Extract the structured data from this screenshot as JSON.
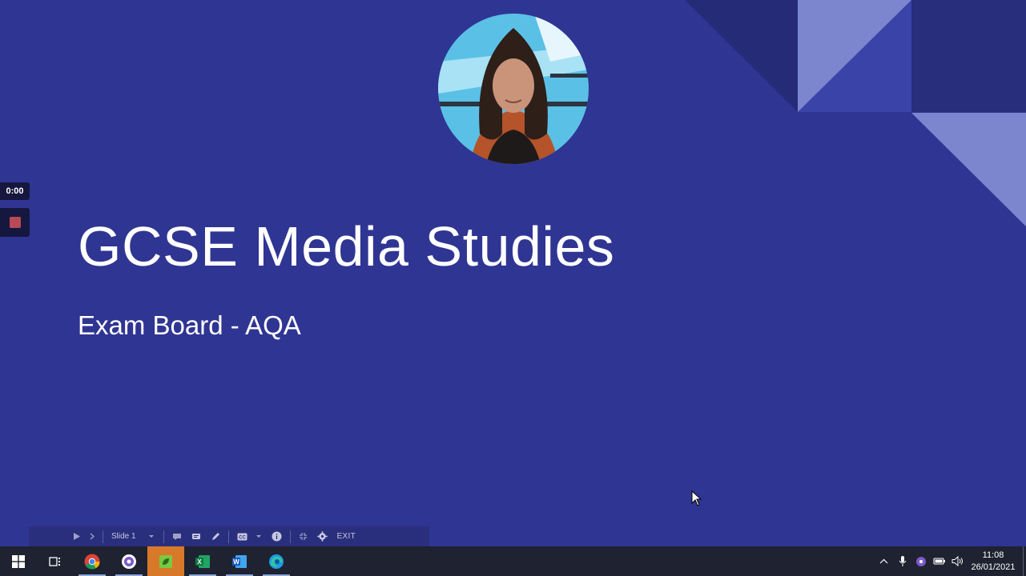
{
  "slide": {
    "title": "GCSE Media Studies",
    "subtitle": "Exam Board - AQA"
  },
  "recorder": {
    "timer": "0:00"
  },
  "presenter_bar": {
    "slide_label": "Slide 1",
    "exit_label": "EXIT"
  },
  "taskbar": {
    "apps": [
      "start",
      "task-view",
      "chrome",
      "settings-app",
      "active-app",
      "excel",
      "word",
      "edge"
    ],
    "active_app": "active-app"
  },
  "tray": {
    "time": "11:08",
    "date": "26/01/2021"
  },
  "colors": {
    "slide_bg": "#2f3592",
    "taskbar_bg": "#1f2230",
    "active_app": "#d8792a"
  }
}
